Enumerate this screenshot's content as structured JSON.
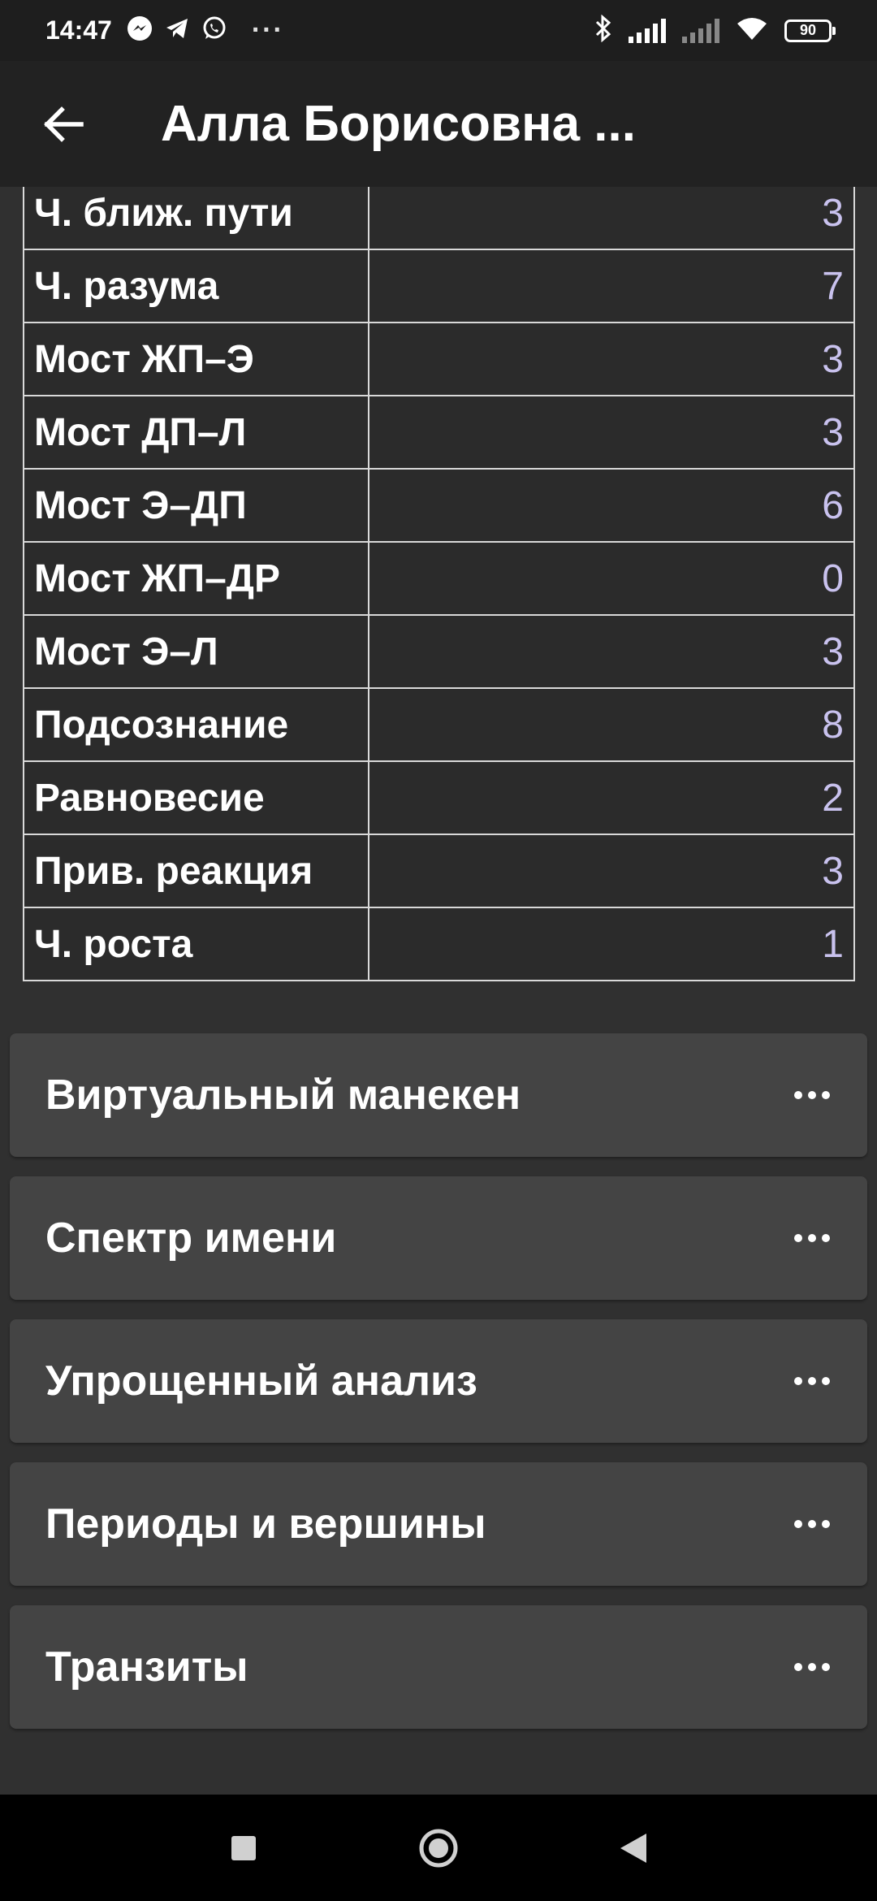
{
  "status_bar": {
    "time": "14:47",
    "icons": [
      "messenger-icon",
      "telegram-icon",
      "whatsapp-icon"
    ],
    "overflow": "···",
    "battery": "90"
  },
  "app_bar": {
    "title": "Алла Борисовна ..."
  },
  "table": {
    "rows": [
      {
        "name": "Ч. ближ. пути",
        "value": "3"
      },
      {
        "name": "Ч. разума",
        "value": "7"
      },
      {
        "name": "Мост ЖП–Э",
        "value": "3"
      },
      {
        "name": "Мост ДП–Л",
        "value": "3"
      },
      {
        "name": "Мост Э–ДП",
        "value": "6"
      },
      {
        "name": "Мост ЖП–ДР",
        "value": "0"
      },
      {
        "name": "Мост Э–Л",
        "value": "3"
      },
      {
        "name": "Подсознание",
        "value": "8"
      },
      {
        "name": "Равновесие",
        "value": "2"
      },
      {
        "name": "Прив. реакция",
        "value": "3"
      },
      {
        "name": "Ч. роста",
        "value": "1"
      }
    ]
  },
  "sections": [
    {
      "title": "Виртуальный манекен"
    },
    {
      "title": "Спектр имени"
    },
    {
      "title": "Упрощенный анализ"
    },
    {
      "title": "Периоды и вершины"
    },
    {
      "title": "Транзиты"
    }
  ],
  "colors": {
    "background": "#303030",
    "app_bar": "#222222",
    "card": "#444444",
    "value_text": "#c9c2ee",
    "border": "#d9d9d9"
  }
}
